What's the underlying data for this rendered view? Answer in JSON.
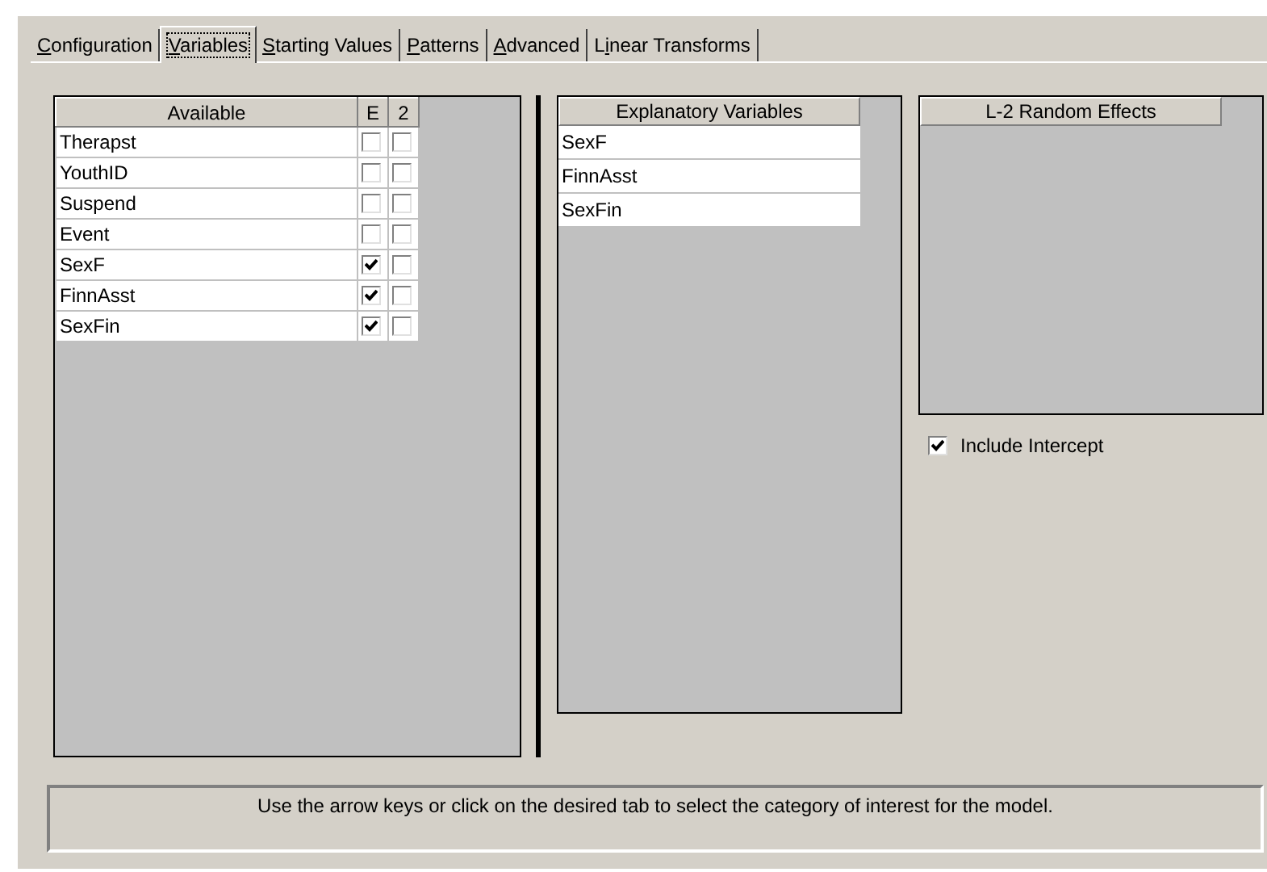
{
  "tabs": [
    {
      "access_key": "C",
      "label_rest": "onfiguration",
      "selected": false
    },
    {
      "access_key": "V",
      "label_rest": "ariables",
      "selected": true
    },
    {
      "access_key": "S",
      "label_rest": "tarting Values",
      "selected": false
    },
    {
      "access_key": "P",
      "label_rest": "atterns",
      "selected": false
    },
    {
      "access_key": "A",
      "label_rest": "dvanced",
      "selected": false
    },
    {
      "label_start": "L",
      "access_key": "i",
      "label_rest": "near Transforms",
      "selected": false
    }
  ],
  "available": {
    "columns": [
      "Available",
      "E",
      "2"
    ],
    "rows": [
      {
        "name": "Therapst",
        "e": false,
        "two": false
      },
      {
        "name": "YouthID",
        "e": false,
        "two": false
      },
      {
        "name": "Suspend",
        "e": false,
        "two": false
      },
      {
        "name": "Event",
        "e": false,
        "two": false
      },
      {
        "name": "SexF",
        "e": true,
        "two": false
      },
      {
        "name": "FinnAsst",
        "e": true,
        "two": false
      },
      {
        "name": "SexFin",
        "e": true,
        "two": false
      }
    ]
  },
  "explanatory": {
    "header": "Explanatory Variables",
    "rows": [
      "SexF",
      "FinnAsst",
      "SexFin"
    ]
  },
  "random_effects": {
    "header": "L-2 Random Effects"
  },
  "include_intercept": {
    "label": "Include Intercept",
    "checked": true
  },
  "status": "Use the arrow keys or click on the desired tab to select the category of interest for the model."
}
